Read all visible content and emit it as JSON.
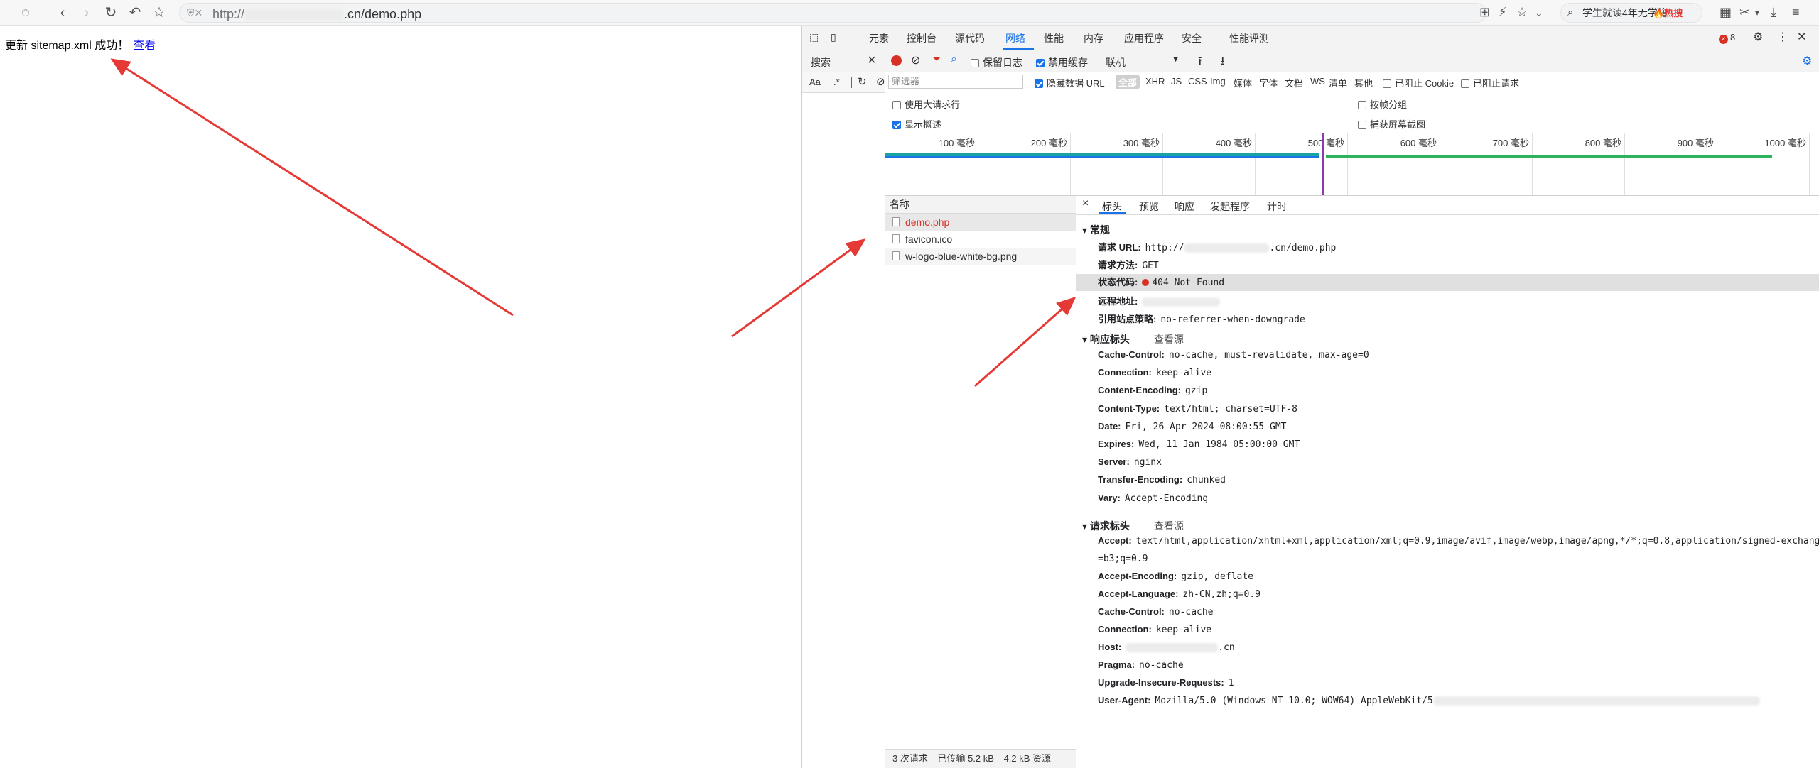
{
  "browser": {
    "url_prefix": "http://",
    "url_suffix": ".cn/demo.php",
    "search_text": "学生就读4年无学籍",
    "hot_label": "热搜"
  },
  "page": {
    "message": "更新 sitemap.xml 成功！",
    "link": "查看"
  },
  "devtools": {
    "tabs": [
      "元素",
      "控制台",
      "源代码",
      "网络",
      "性能",
      "内存",
      "应用程序",
      "安全",
      "性能评测"
    ],
    "active_tab": "网络",
    "error_count": "8",
    "search_pane_title": "搜索",
    "search_opts": [
      "Aa",
      ".*"
    ],
    "net_toolbar": {
      "preserve_log": "保留日志",
      "disable_cache": "禁用缓存",
      "throttle": "联机"
    },
    "filter_placeholder": "筛选器",
    "hide_data_url": "隐藏数据 URL",
    "type_filters": [
      "全部",
      "XHR",
      "JS",
      "CSS",
      "Img",
      "媒体",
      "字体",
      "文档",
      "WS",
      "清单",
      "其他"
    ],
    "blocked_cookie": "已阻止 Cookie",
    "blocked_requests": "已阻止请求",
    "options": {
      "large_rows": "使用大请求行",
      "show_overview": "显示概述",
      "group_by_frame": "按帧分组",
      "capture_screenshots": "捕获屏幕截图"
    },
    "timeline_ticks": [
      "100 毫秒",
      "200 毫秒",
      "300 毫秒",
      "400 毫秒",
      "500 毫秒",
      "600 毫秒",
      "700 毫秒",
      "800 毫秒",
      "900 毫秒",
      "1000 毫秒"
    ],
    "request_list_header": "名称",
    "requests": [
      "demo.php",
      "favicon.ico",
      "w-logo-blue-white-bg.png"
    ],
    "summary": [
      "3 次请求",
      "已传输 5.2 kB",
      "4.2 kB 资源"
    ],
    "detail_tabs": [
      "标头",
      "预览",
      "响应",
      "发起程序",
      "计时"
    ],
    "general_title": "常规",
    "general": {
      "url_key": "请求 URL:",
      "url_prefix": "http://",
      "url_suffix": ".cn/demo.php",
      "method_key": "请求方法:",
      "method": "GET",
      "status_key": "状态代码:",
      "status": "404 Not Found",
      "remote_key": "远程地址:",
      "referrer_key": "引用站点策略:",
      "referrer": "no-referrer-when-downgrade"
    },
    "response_headers_title": "响应标头",
    "request_headers_title": "请求标头",
    "view_source": "查看源",
    "response_headers": [
      {
        "k": "Cache-Control:",
        "v": "no-cache, must-revalidate, max-age=0"
      },
      {
        "k": "Connection:",
        "v": "keep-alive"
      },
      {
        "k": "Content-Encoding:",
        "v": "gzip"
      },
      {
        "k": "Content-Type:",
        "v": "text/html; charset=UTF-8"
      },
      {
        "k": "Date:",
        "v": "Fri, 26 Apr 2024 08:00:55 GMT"
      },
      {
        "k": "Expires:",
        "v": "Wed, 11 Jan 1984 05:00:00 GMT"
      },
      {
        "k": "Server:",
        "v": "nginx"
      },
      {
        "k": "Transfer-Encoding:",
        "v": "chunked"
      },
      {
        "k": "Vary:",
        "v": "Accept-Encoding"
      }
    ],
    "request_headers": [
      {
        "k": "Accept:",
        "v": "text/html,application/xhtml+xml,application/xml;q=0.9,image/avif,image/webp,image/apng,*/*;q=0.8,application/signed-exchange;v"
      },
      {
        "k": "",
        "v": "=b3;q=0.9"
      },
      {
        "k": "Accept-Encoding:",
        "v": "gzip, deflate"
      },
      {
        "k": "Accept-Language:",
        "v": "zh-CN,zh;q=0.9"
      },
      {
        "k": "Cache-Control:",
        "v": "no-cache"
      },
      {
        "k": "Connection:",
        "v": "keep-alive"
      },
      {
        "k": "Host:",
        "v": ".cn"
      },
      {
        "k": "Pragma:",
        "v": "no-cache"
      },
      {
        "k": "Upgrade-Insecure-Requests:",
        "v": "1"
      },
      {
        "k": "User-Agent:",
        "v": "Mozilla/5.0 (Windows NT 10.0; WOW64) AppleWebKit/5"
      }
    ]
  }
}
